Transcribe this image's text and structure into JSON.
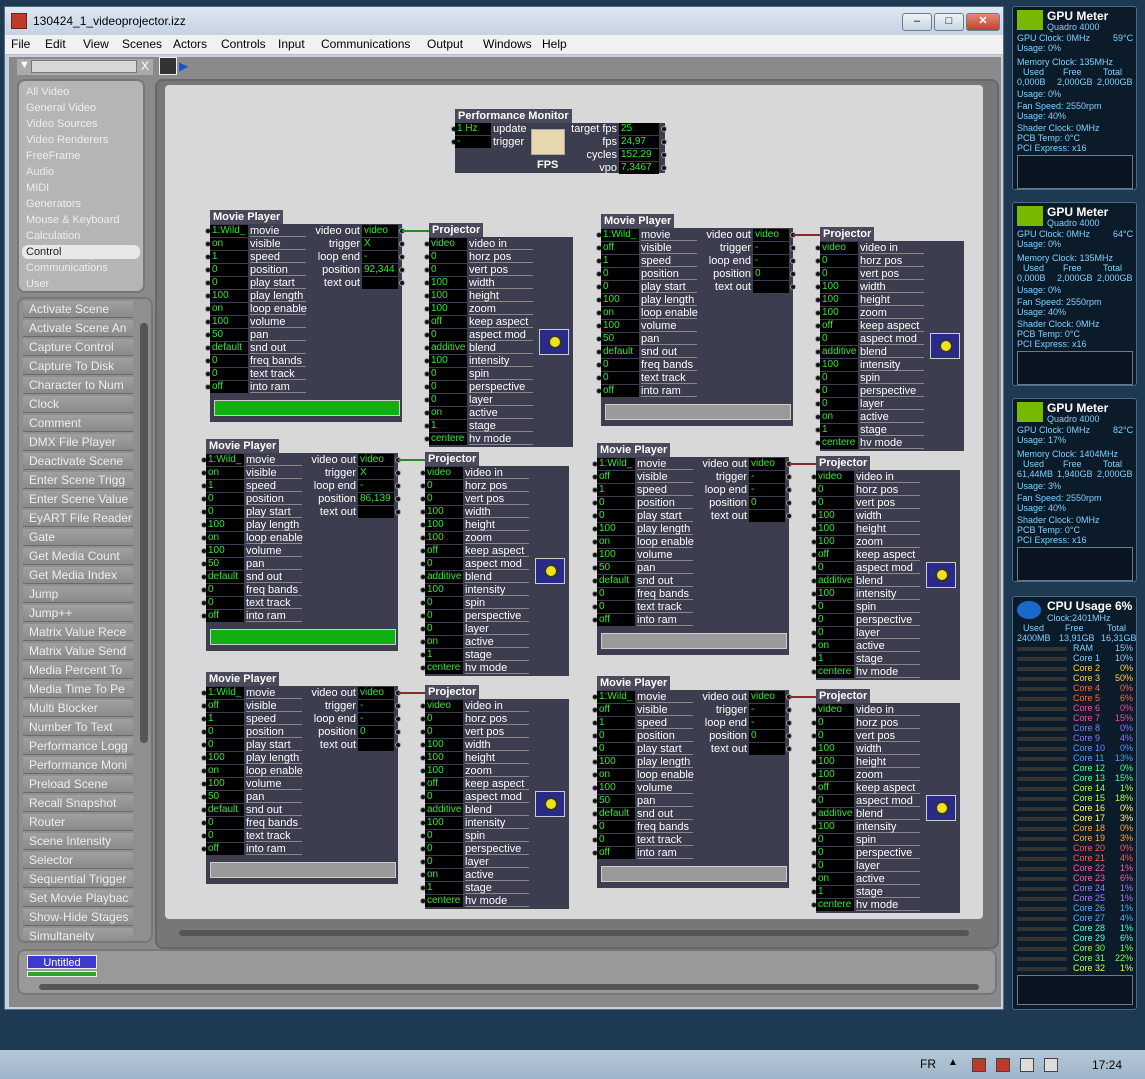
{
  "window": {
    "title": "130424_1_videoprojector.izz",
    "min": "–",
    "max": "□",
    "close": "✕"
  },
  "menu": [
    "File",
    "Edit",
    "View",
    "Scenes",
    "Actors",
    "Controls",
    "Input",
    "Communications",
    "Output",
    "Windows",
    "Help"
  ],
  "search": {
    "placeholder": "",
    "clear": "X",
    "dropdown": "▼"
  },
  "categories": [
    "All Video",
    "General Video",
    "Video Sources",
    "Video Renderers",
    "FreeFrame",
    "Audio",
    "MIDI",
    "Generators",
    "Mouse & Keyboard",
    "Calculation",
    "Control",
    "Communications",
    "User"
  ],
  "selected_category": "Control",
  "actors": [
    "Activate Scene",
    "Activate Scene An",
    "Capture Control",
    "Capture To Disk",
    "Character to Num",
    "Clock",
    "Comment",
    "DMX File Player",
    "Deactivate Scene",
    "Enter Scene Trigg",
    "Enter Scene Value",
    "EyART File Reader",
    "Gate",
    "Get Media Count",
    "Get Media Index",
    "Jump",
    "Jump++",
    "Matrix Value Rece",
    "Matrix Value Send",
    "Media Percent To",
    "Media Time To Pe",
    "Multi Blocker",
    "Number To Text",
    "Performance Logg",
    "Performance Moni",
    "Preload Scene",
    "Recall Snapshot",
    "Router",
    "Scene Intensity",
    "Selector",
    "Sequential Trigger",
    "Set Movie Playbac",
    "Show-Hide Stages",
    "Simultaneity"
  ],
  "perf_monitor": {
    "title": "Performance Monitor",
    "inputs": [
      {
        "value": "1 Hz",
        "label": "update"
      },
      {
        "value": "-",
        "label": "trigger"
      }
    ],
    "outputs": [
      {
        "label": "target fps",
        "value": "25"
      },
      {
        "label": "fps",
        "value": "24,97"
      },
      {
        "label": "cycles",
        "value": "152,29"
      },
      {
        "label": "vpo",
        "value": "7,3467"
      }
    ],
    "icon_text": "FPS"
  },
  "movie_player": {
    "title": "Movie Player",
    "input_labels": [
      "movie",
      "visible",
      "speed",
      "position",
      "play start",
      "play length",
      "loop enable",
      "volume",
      "pan",
      "snd out",
      "freq bands",
      "text track",
      "into ram"
    ],
    "output_labels": [
      "video out",
      "trigger",
      "loop end",
      "position",
      "text out"
    ]
  },
  "movie_players": [
    {
      "inputs": [
        "1:Wild_",
        "on",
        "1",
        "0",
        "0",
        "100",
        "on",
        "100",
        "50",
        "default",
        "0",
        "0",
        "off"
      ],
      "outputs": [
        "video",
        "X",
        "-",
        "92,344",
        ""
      ],
      "bar": "green"
    },
    {
      "inputs": [
        "1:Wild_",
        "off",
        "1",
        "0",
        "0",
        "100",
        "on",
        "100",
        "50",
        "default",
        "0",
        "0",
        "off"
      ],
      "outputs": [
        "video",
        "-",
        "-",
        "0",
        ""
      ],
      "bar": "grey"
    },
    {
      "inputs": [
        "1:Wild_",
        "on",
        "1",
        "0",
        "0",
        "100",
        "on",
        "100",
        "50",
        "default",
        "0",
        "0",
        "off"
      ],
      "outputs": [
        "video",
        "X",
        "-",
        "86,139",
        ""
      ],
      "bar": "green"
    },
    {
      "inputs": [
        "1:Wild_",
        "off",
        "1",
        "0",
        "0",
        "100",
        "on",
        "100",
        "50",
        "default",
        "0",
        "0",
        "off"
      ],
      "outputs": [
        "video",
        "-",
        "-",
        "0",
        ""
      ],
      "bar": "grey"
    },
    {
      "inputs": [
        "1:Wild_",
        "off",
        "1",
        "0",
        "0",
        "100",
        "on",
        "100",
        "50",
        "default",
        "0",
        "0",
        "off"
      ],
      "outputs": [
        "video",
        "-",
        "-",
        "0",
        ""
      ],
      "bar": "grey"
    },
    {
      "inputs": [
        "1:Wild_",
        "off",
        "1",
        "0",
        "0",
        "100",
        "on",
        "100",
        "50",
        "default",
        "0",
        "0",
        "off"
      ],
      "outputs": [
        "video",
        "-",
        "-",
        "0",
        ""
      ],
      "bar": "grey"
    }
  ],
  "projector": {
    "title": "Projector",
    "labels": [
      "video in",
      "horz pos",
      "vert pos",
      "width",
      "height",
      "zoom",
      "keep aspect",
      "aspect mod",
      "blend",
      "intensity",
      "spin",
      "perspective",
      "layer",
      "active",
      "stage",
      "hv mode"
    ],
    "values": [
      "video",
      "0",
      "0",
      "100",
      "100",
      "100",
      "off",
      "0",
      "additive",
      "100",
      "0",
      "0",
      "0",
      "on",
      "1",
      "centere"
    ]
  },
  "bottom": {
    "scene_name": "Untitled"
  },
  "gpu_meters": [
    {
      "title": "GPU Meter",
      "model": "Quadro 4000",
      "clock": "GPU Clock: 0MHz",
      "temp": "59°C",
      "usage": "Usage: 0%",
      "mem_clock": "Memory Clock: 135MHz",
      "mem_hdr": [
        "Used",
        "Free",
        "Total"
      ],
      "mem_vals": [
        "0,000B",
        "2,000GB",
        "2,000GB"
      ],
      "mem_usage": "Usage: 0%",
      "fan": "Fan Speed: 2550rpm",
      "fan_usage": "Usage: 40%",
      "shader": "Shader Clock: 0MHz",
      "pcb": "PCB Temp: 0°C",
      "pci": "PCI Express: x16"
    },
    {
      "title": "GPU Meter",
      "model": "Quadro 4000",
      "clock": "GPU Clock: 0MHz",
      "temp": "64°C",
      "usage": "Usage: 0%",
      "mem_clock": "Memory Clock: 135MHz",
      "mem_hdr": [
        "Used",
        "Free",
        "Total"
      ],
      "mem_vals": [
        "0,000B",
        "2,000GB",
        "2,000GB"
      ],
      "mem_usage": "Usage: 0%",
      "fan": "Fan Speed: 2550rpm",
      "fan_usage": "Usage: 40%",
      "shader": "Shader Clock: 0MHz",
      "pcb": "PCB Temp: 0°C",
      "pci": "PCI Express: x16"
    },
    {
      "title": "GPU Meter",
      "model": "Quadro 4000",
      "clock": "GPU Clock: 0MHz",
      "temp": "82°C",
      "usage": "Usage: 17%",
      "mem_clock": "Memory Clock: 1404MHz",
      "mem_hdr": [
        "Used",
        "Free",
        "Total"
      ],
      "mem_vals": [
        "61,44MB",
        "1,940GB",
        "2,000GB"
      ],
      "mem_usage": "Usage: 3%",
      "fan": "Fan Speed: 2550rpm",
      "fan_usage": "Usage: 40%",
      "shader": "Shader Clock: 0MHz",
      "pcb": "PCB Temp: 0°C",
      "pci": "PCI Express: x16"
    }
  ],
  "cpu_meter": {
    "title": "CPU Usage",
    "total": "6%",
    "clock": "Clock:2401MHz",
    "mem_hdr": [
      "Used",
      "Free",
      "Total"
    ],
    "mem_vals": [
      "2400MB",
      "13,91GB",
      "16,31GB"
    ],
    "rows": [
      [
        "RAM",
        "15%"
      ],
      [
        "Core 1",
        "10%"
      ],
      [
        "Core 2",
        "0%"
      ],
      [
        "Core 3",
        "50%"
      ],
      [
        "Core 4",
        "0%"
      ],
      [
        "Core 5",
        "6%"
      ],
      [
        "Core 6",
        "0%"
      ],
      [
        "Core 7",
        "15%"
      ],
      [
        "Core 8",
        "0%"
      ],
      [
        "Core 9",
        "4%"
      ],
      [
        "Core 10",
        "0%"
      ],
      [
        "Core 11",
        "13%"
      ],
      [
        "Core 12",
        "0%"
      ],
      [
        "Core 13",
        "15%"
      ],
      [
        "Core 14",
        "1%"
      ],
      [
        "Core 15",
        "18%"
      ],
      [
        "Core 16",
        "0%"
      ],
      [
        "Core 17",
        "3%"
      ],
      [
        "Core 18",
        "0%"
      ],
      [
        "Core 19",
        "3%"
      ],
      [
        "Core 20",
        "0%"
      ],
      [
        "Core 21",
        "4%"
      ],
      [
        "Core 22",
        "1%"
      ],
      [
        "Core 23",
        "6%"
      ],
      [
        "Core 24",
        "1%"
      ],
      [
        "Core 25",
        "1%"
      ],
      [
        "Core 26",
        "1%"
      ],
      [
        "Core 27",
        "4%"
      ],
      [
        "Core 28",
        "1%"
      ],
      [
        "Core 29",
        "6%"
      ],
      [
        "Core 30",
        "1%"
      ],
      [
        "Core 31",
        "22%"
      ],
      [
        "Core 32",
        "1%"
      ]
    ]
  },
  "taskbar": {
    "lang": "FR",
    "time": "17:24"
  }
}
